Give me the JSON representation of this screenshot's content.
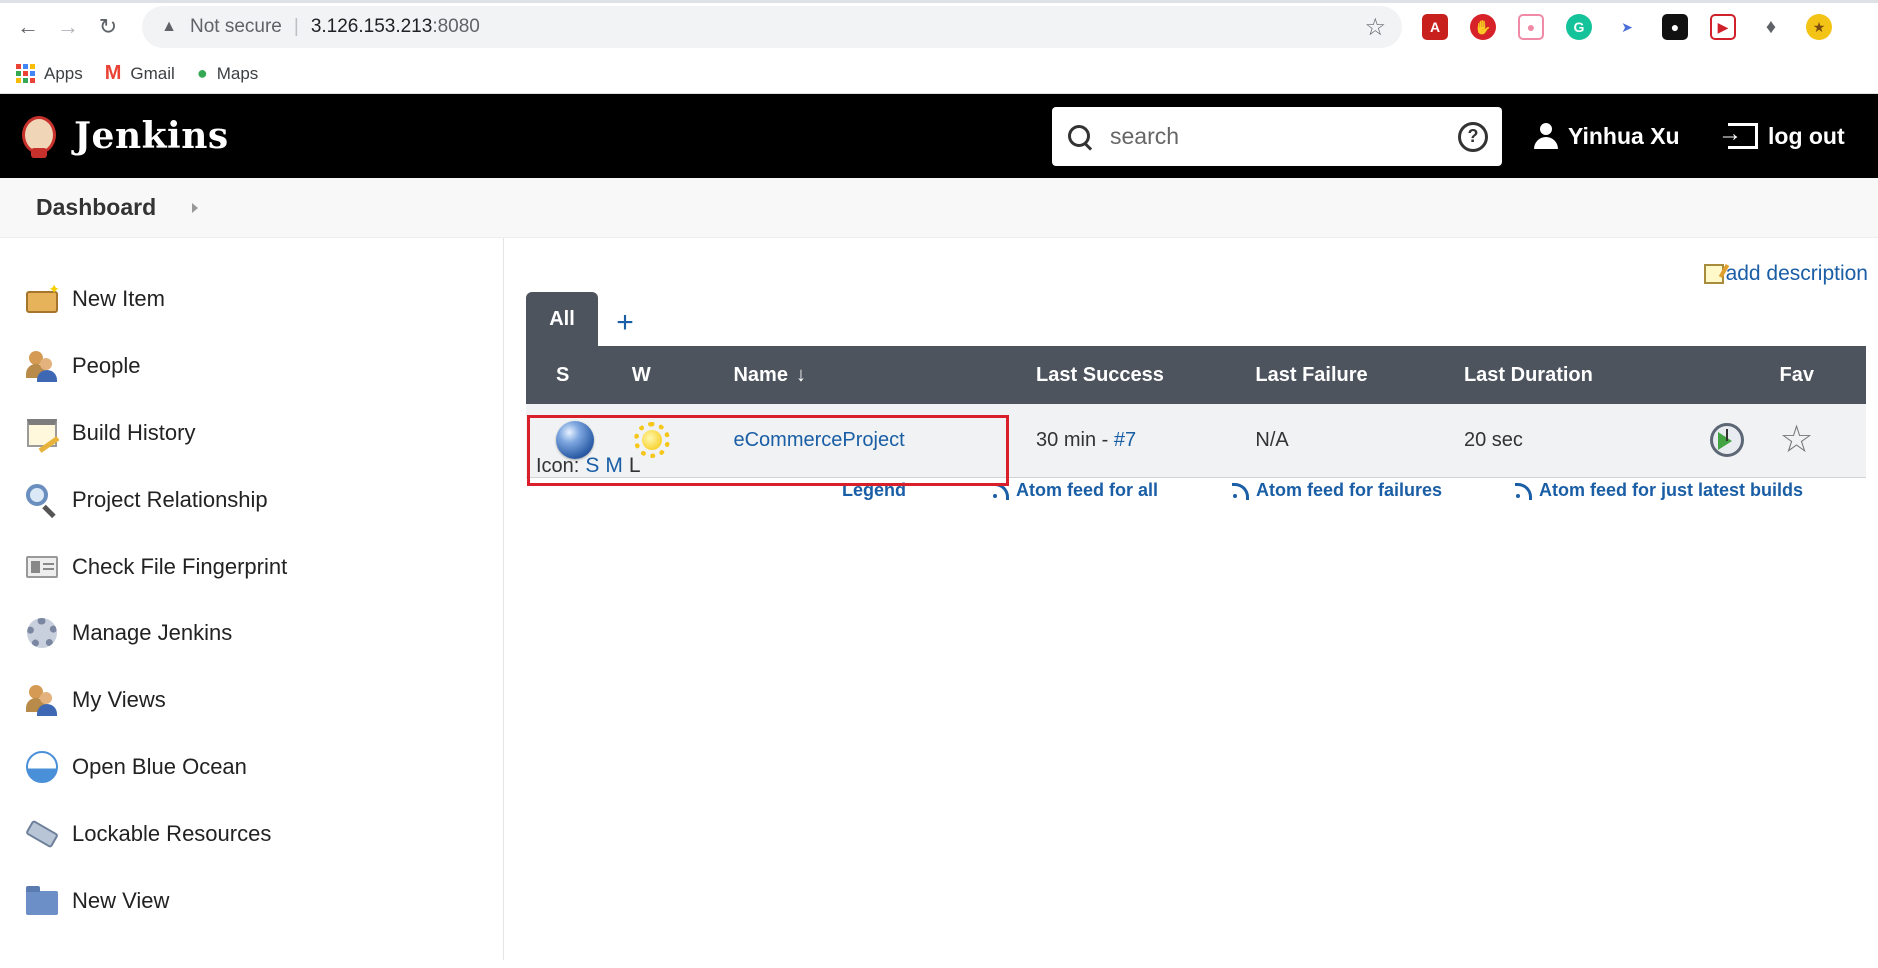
{
  "browser": {
    "security_label": "Not secure",
    "url_host": "3.126.153.213",
    "url_port": ":8080",
    "bookmarks": [
      {
        "label": "Apps",
        "icon": "apps-grid-icon"
      },
      {
        "label": "Gmail",
        "icon": "gmail-icon"
      },
      {
        "label": "Maps",
        "icon": "maps-pin-icon"
      }
    ],
    "extensions": [
      "acrobat-icon",
      "adblock-icon",
      "extension-pink-icon",
      "grammarly-icon",
      "extension-bird-icon",
      "extension-dark-icon",
      "extension-red-icon",
      "puzzle-icon",
      "profile-avatar-icon"
    ]
  },
  "header": {
    "brand": "Jenkins",
    "search_placeholder": "search",
    "user_name": "Yinhua Xu",
    "logout_label": "log out"
  },
  "breadcrumb": {
    "items": [
      "Dashboard"
    ]
  },
  "sidebar": {
    "items": [
      {
        "label": "New Item",
        "icon": "new-item-icon"
      },
      {
        "label": "People",
        "icon": "people-icon"
      },
      {
        "label": "Build History",
        "icon": "build-history-icon"
      },
      {
        "label": "Project Relationship",
        "icon": "magnifier-icon"
      },
      {
        "label": "Check File Fingerprint",
        "icon": "fingerprint-card-icon"
      },
      {
        "label": "Manage Jenkins",
        "icon": "gear-icon"
      },
      {
        "label": "My Views",
        "icon": "people-icon"
      },
      {
        "label": "Open Blue Ocean",
        "icon": "blue-ocean-icon"
      },
      {
        "label": "Lockable Resources",
        "icon": "usb-drive-icon"
      },
      {
        "label": "New View",
        "icon": "folder-icon"
      }
    ]
  },
  "main": {
    "add_description": "add description",
    "tabs": [
      {
        "label": "All",
        "active": true
      },
      {
        "label": "+",
        "active": false
      }
    ],
    "table": {
      "headers": [
        "S",
        "W",
        "Name",
        "Last Success",
        "Last Failure",
        "Last Duration",
        "",
        "Fav"
      ],
      "sort_arrow": "↓",
      "rows": [
        {
          "status_icon": "blue-ball-icon",
          "weather_icon": "sunny-icon",
          "name": "eCommerceProject",
          "last_success_time": "30 min",
          "last_success_sep": "-",
          "last_success_build": "#7",
          "last_failure": "N/A",
          "last_duration": "20 sec"
        }
      ]
    },
    "icon_size": {
      "label": "Icon:",
      "options": [
        "S",
        "M",
        "L"
      ],
      "current": "L"
    },
    "footer_links": {
      "legend": "Legend",
      "atom_all": "Atom feed for all",
      "atom_failures": "Atom feed for failures",
      "atom_latest": "Atom feed for just latest builds"
    }
  },
  "colors": {
    "header_bg": "#000000",
    "table_header_bg": "#4d545d",
    "link": "#1a5ea5",
    "highlight_box": "#d9202a"
  }
}
